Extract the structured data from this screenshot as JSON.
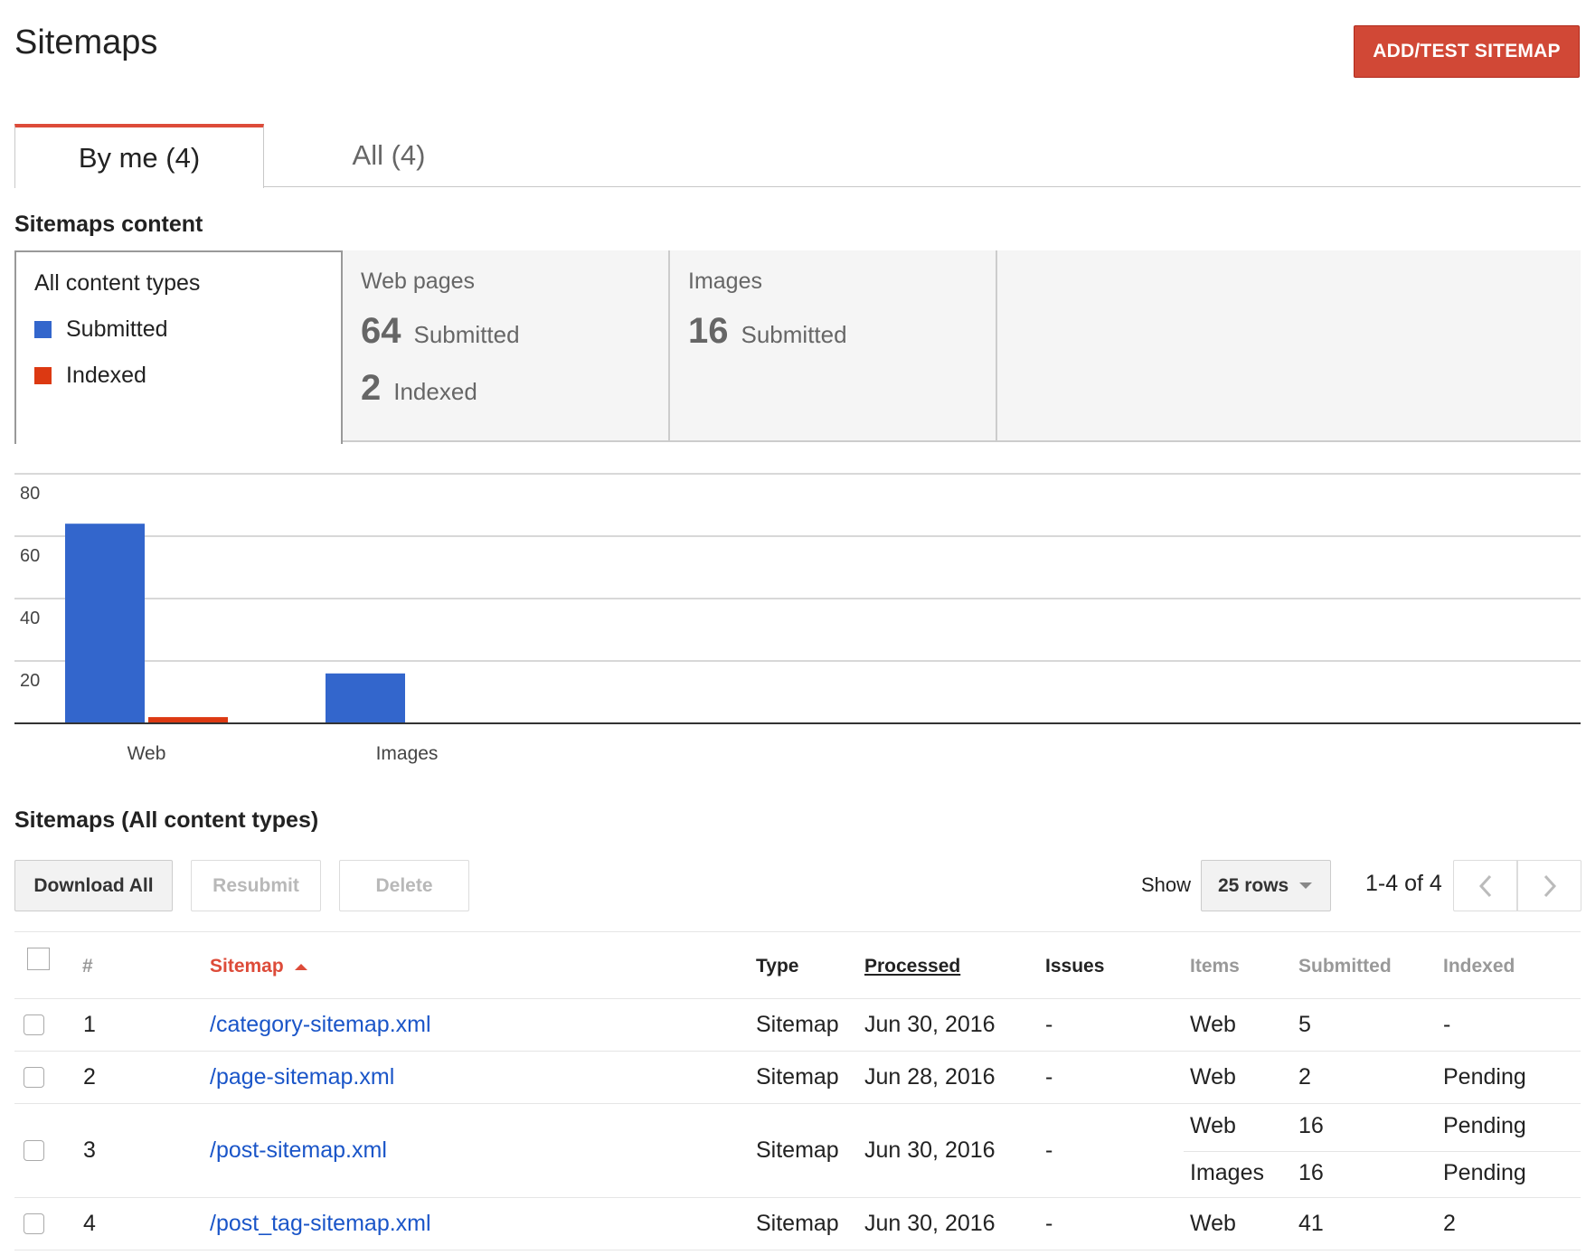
{
  "header": {
    "title": "Sitemaps",
    "add_button": "ADD/TEST SITEMAP"
  },
  "tabs": [
    {
      "label": "By me (4)",
      "active": true
    },
    {
      "label": "All (4)",
      "active": false
    }
  ],
  "content_section": {
    "title": "Sitemaps content",
    "all_card": {
      "title": "All content types",
      "legend": [
        {
          "label": "Submitted",
          "color": "#3366cc"
        },
        {
          "label": "Indexed",
          "color": "#dc3912"
        }
      ]
    },
    "web_card": {
      "title": "Web pages",
      "submitted": "64",
      "submitted_label": "Submitted",
      "indexed": "2",
      "indexed_label": "Indexed"
    },
    "images_card": {
      "title": "Images",
      "submitted": "16",
      "submitted_label": "Submitted"
    }
  },
  "chart_data": {
    "type": "bar",
    "categories": [
      "Web",
      "Images"
    ],
    "series": [
      {
        "name": "Submitted",
        "values": [
          64,
          16
        ],
        "color": "#3366cc"
      },
      {
        "name": "Indexed",
        "values": [
          2,
          0
        ],
        "color": "#dc3912"
      }
    ],
    "yticks": [
      20,
      40,
      60,
      80
    ],
    "ylim": [
      0,
      80
    ],
    "grid": true
  },
  "table_section": {
    "title": "Sitemaps (All content types)",
    "actions": {
      "download": "Download All",
      "resubmit": "Resubmit",
      "delete": "Delete"
    },
    "show_label": "Show",
    "rows_selected": "25 rows",
    "page_range": "1-4 of 4",
    "columns": {
      "num": "#",
      "sitemap": "Sitemap",
      "type": "Type",
      "processed": "Processed",
      "issues": "Issues",
      "items": "Items",
      "submitted": "Submitted",
      "indexed": "Indexed"
    },
    "rows": [
      {
        "num": "1",
        "sitemap": "/category-sitemap.xml",
        "type": "Sitemap",
        "processed": "Jun 30, 2016",
        "issues": "-",
        "items": [
          {
            "item": "Web",
            "submitted": "5",
            "indexed": "-"
          }
        ]
      },
      {
        "num": "2",
        "sitemap": "/page-sitemap.xml",
        "type": "Sitemap",
        "processed": "Jun 28, 2016",
        "issues": "-",
        "items": [
          {
            "item": "Web",
            "submitted": "2",
            "indexed": "Pending"
          }
        ]
      },
      {
        "num": "3",
        "sitemap": "/post-sitemap.xml",
        "type": "Sitemap",
        "processed": "Jun 30, 2016",
        "issues": "-",
        "items": [
          {
            "item": "Web",
            "submitted": "16",
            "indexed": "Pending"
          },
          {
            "item": "Images",
            "submitted": "16",
            "indexed": "Pending"
          }
        ]
      },
      {
        "num": "4",
        "sitemap": "/post_tag-sitemap.xml",
        "type": "Sitemap",
        "processed": "Jun 30, 2016",
        "issues": "-",
        "items": [
          {
            "item": "Web",
            "submitted": "41",
            "indexed": "2"
          }
        ]
      }
    ]
  }
}
